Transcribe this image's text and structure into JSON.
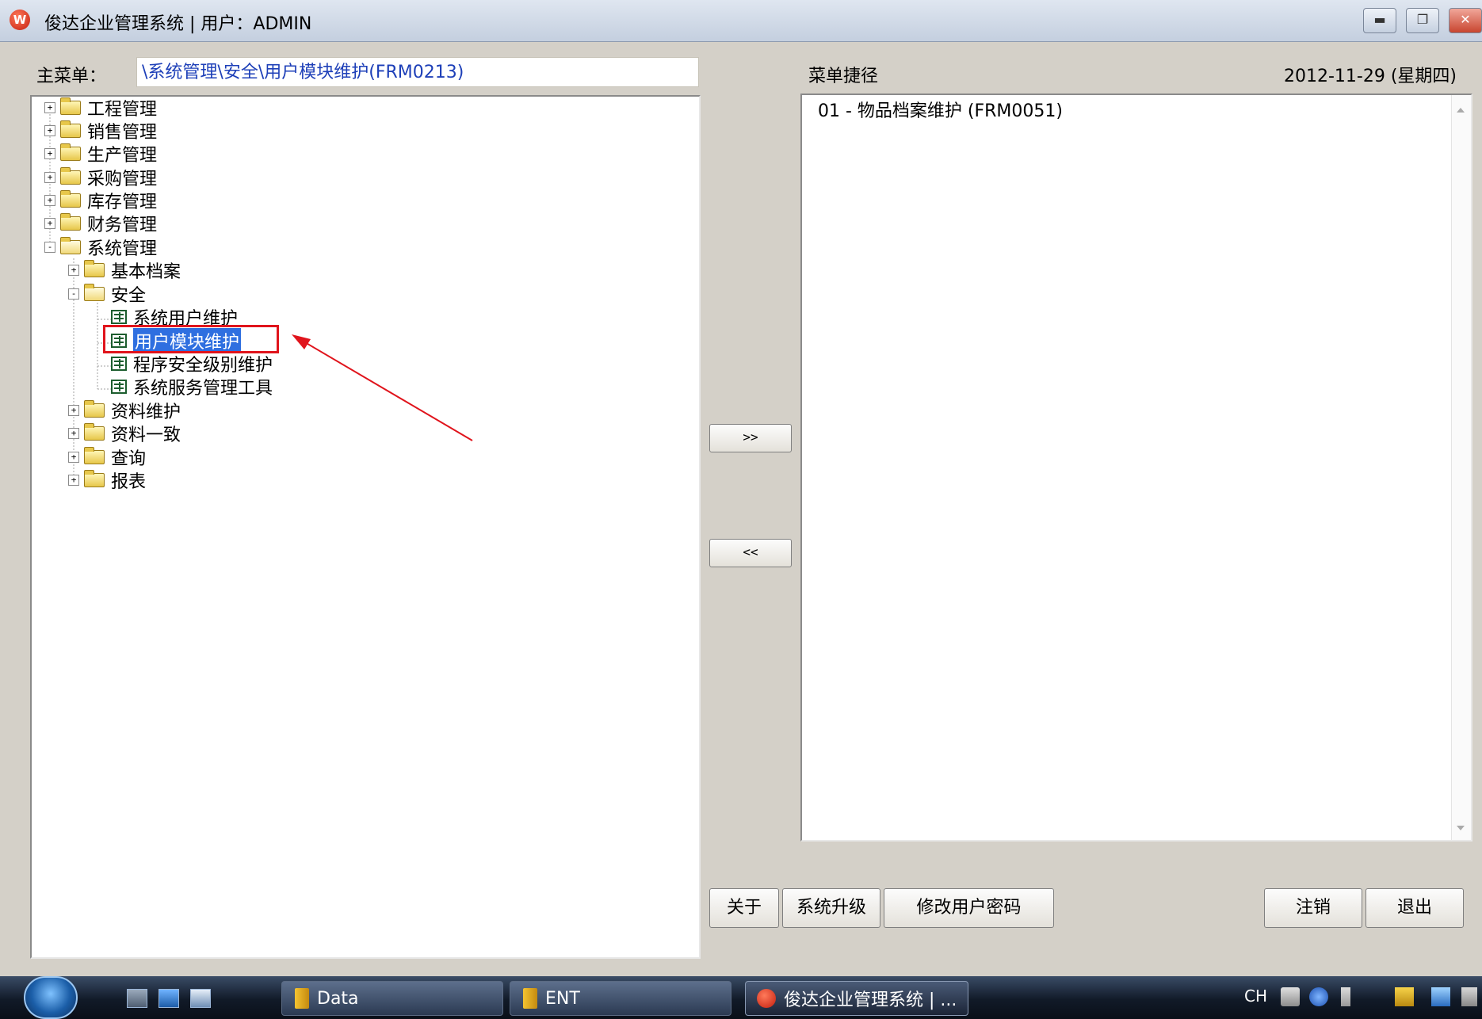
{
  "window": {
    "title": "俊达企业管理系统 | 用户：ADMIN",
    "app_icon_glyph": "W"
  },
  "main_menu_label": "主菜单：",
  "current_path": "\\系统管理\\安全\\用户模块维护(FRM0213)",
  "shortcut_label": "菜单捷径",
  "date_display": "2012-11-29 (星期四)",
  "tree": [
    {
      "label": "工程管理",
      "expander": "+",
      "icon": "folder-icon"
    },
    {
      "label": "销售管理",
      "expander": "+",
      "icon": "folder-icon"
    },
    {
      "label": "生产管理",
      "expander": "+",
      "icon": "folder-icon"
    },
    {
      "label": "采购管理",
      "expander": "+",
      "icon": "folder-icon"
    },
    {
      "label": "库存管理",
      "expander": "+",
      "icon": "folder-icon"
    },
    {
      "label": "财务管理",
      "expander": "+",
      "icon": "folder-icon"
    },
    {
      "label": "系统管理",
      "expander": "-",
      "icon": "open-folder-icon"
    },
    {
      "label": "基本档案",
      "expander": "+",
      "icon": "folder-icon"
    },
    {
      "label": "安全",
      "expander": "-",
      "icon": "open-folder-icon"
    },
    {
      "label": "系统用户维护",
      "icon": "form-icon"
    },
    {
      "label": "用户模块维护",
      "icon": "form-icon",
      "selected": true
    },
    {
      "label": "程序安全级别维护",
      "icon": "form-icon"
    },
    {
      "label": "系统服务管理工具",
      "icon": "form-icon"
    },
    {
      "label": "资料维护",
      "expander": "+",
      "icon": "folder-icon"
    },
    {
      "label": "资料一致",
      "expander": "+",
      "icon": "folder-icon"
    },
    {
      "label": "查询",
      "expander": "+",
      "icon": "folder-icon"
    },
    {
      "label": "报表",
      "expander": "+",
      "icon": "folder-icon"
    }
  ],
  "shortcuts": [
    "01 - 物品档案维护 (FRM0051)"
  ],
  "buttons": {
    "add": ">>",
    "remove": "<<",
    "about": "关于",
    "upgrade": "系统升级",
    "change_password": "修改用户密码",
    "logout": "注销",
    "exit": "退出"
  },
  "taskbar": {
    "items": [
      "Data",
      "ENT",
      "俊达企业管理系统 | ..."
    ],
    "tray_lang": "CH"
  },
  "colors": {
    "selection": "#2f6fe0",
    "annotation": "#e0141c",
    "path_text": "#1d3fb8"
  }
}
